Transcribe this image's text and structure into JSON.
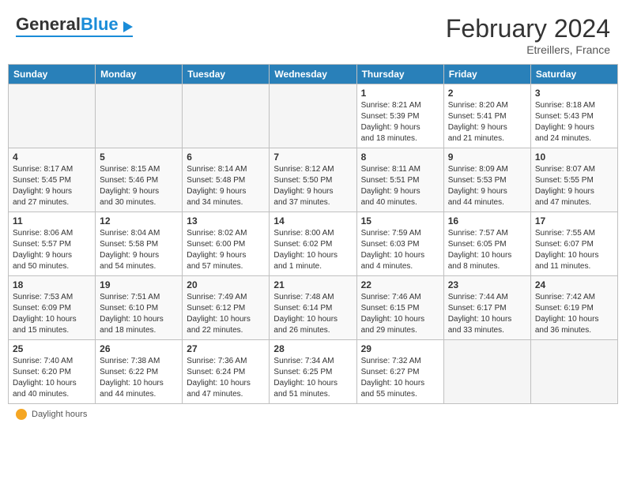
{
  "header": {
    "logo_general": "General",
    "logo_blue": "Blue",
    "month_year": "February 2024",
    "location": "Etreillers, France"
  },
  "days_of_week": [
    "Sunday",
    "Monday",
    "Tuesday",
    "Wednesday",
    "Thursday",
    "Friday",
    "Saturday"
  ],
  "weeks": [
    [
      {
        "day": "",
        "info": ""
      },
      {
        "day": "",
        "info": ""
      },
      {
        "day": "",
        "info": ""
      },
      {
        "day": "",
        "info": ""
      },
      {
        "day": "1",
        "info": "Sunrise: 8:21 AM\nSunset: 5:39 PM\nDaylight: 9 hours\nand 18 minutes."
      },
      {
        "day": "2",
        "info": "Sunrise: 8:20 AM\nSunset: 5:41 PM\nDaylight: 9 hours\nand 21 minutes."
      },
      {
        "day": "3",
        "info": "Sunrise: 8:18 AM\nSunset: 5:43 PM\nDaylight: 9 hours\nand 24 minutes."
      }
    ],
    [
      {
        "day": "4",
        "info": "Sunrise: 8:17 AM\nSunset: 5:45 PM\nDaylight: 9 hours\nand 27 minutes."
      },
      {
        "day": "5",
        "info": "Sunrise: 8:15 AM\nSunset: 5:46 PM\nDaylight: 9 hours\nand 30 minutes."
      },
      {
        "day": "6",
        "info": "Sunrise: 8:14 AM\nSunset: 5:48 PM\nDaylight: 9 hours\nand 34 minutes."
      },
      {
        "day": "7",
        "info": "Sunrise: 8:12 AM\nSunset: 5:50 PM\nDaylight: 9 hours\nand 37 minutes."
      },
      {
        "day": "8",
        "info": "Sunrise: 8:11 AM\nSunset: 5:51 PM\nDaylight: 9 hours\nand 40 minutes."
      },
      {
        "day": "9",
        "info": "Sunrise: 8:09 AM\nSunset: 5:53 PM\nDaylight: 9 hours\nand 44 minutes."
      },
      {
        "day": "10",
        "info": "Sunrise: 8:07 AM\nSunset: 5:55 PM\nDaylight: 9 hours\nand 47 minutes."
      }
    ],
    [
      {
        "day": "11",
        "info": "Sunrise: 8:06 AM\nSunset: 5:57 PM\nDaylight: 9 hours\nand 50 minutes."
      },
      {
        "day": "12",
        "info": "Sunrise: 8:04 AM\nSunset: 5:58 PM\nDaylight: 9 hours\nand 54 minutes."
      },
      {
        "day": "13",
        "info": "Sunrise: 8:02 AM\nSunset: 6:00 PM\nDaylight: 9 hours\nand 57 minutes."
      },
      {
        "day": "14",
        "info": "Sunrise: 8:00 AM\nSunset: 6:02 PM\nDaylight: 10 hours\nand 1 minute."
      },
      {
        "day": "15",
        "info": "Sunrise: 7:59 AM\nSunset: 6:03 PM\nDaylight: 10 hours\nand 4 minutes."
      },
      {
        "day": "16",
        "info": "Sunrise: 7:57 AM\nSunset: 6:05 PM\nDaylight: 10 hours\nand 8 minutes."
      },
      {
        "day": "17",
        "info": "Sunrise: 7:55 AM\nSunset: 6:07 PM\nDaylight: 10 hours\nand 11 minutes."
      }
    ],
    [
      {
        "day": "18",
        "info": "Sunrise: 7:53 AM\nSunset: 6:09 PM\nDaylight: 10 hours\nand 15 minutes."
      },
      {
        "day": "19",
        "info": "Sunrise: 7:51 AM\nSunset: 6:10 PM\nDaylight: 10 hours\nand 18 minutes."
      },
      {
        "day": "20",
        "info": "Sunrise: 7:49 AM\nSunset: 6:12 PM\nDaylight: 10 hours\nand 22 minutes."
      },
      {
        "day": "21",
        "info": "Sunrise: 7:48 AM\nSunset: 6:14 PM\nDaylight: 10 hours\nand 26 minutes."
      },
      {
        "day": "22",
        "info": "Sunrise: 7:46 AM\nSunset: 6:15 PM\nDaylight: 10 hours\nand 29 minutes."
      },
      {
        "day": "23",
        "info": "Sunrise: 7:44 AM\nSunset: 6:17 PM\nDaylight: 10 hours\nand 33 minutes."
      },
      {
        "day": "24",
        "info": "Sunrise: 7:42 AM\nSunset: 6:19 PM\nDaylight: 10 hours\nand 36 minutes."
      }
    ],
    [
      {
        "day": "25",
        "info": "Sunrise: 7:40 AM\nSunset: 6:20 PM\nDaylight: 10 hours\nand 40 minutes."
      },
      {
        "day": "26",
        "info": "Sunrise: 7:38 AM\nSunset: 6:22 PM\nDaylight: 10 hours\nand 44 minutes."
      },
      {
        "day": "27",
        "info": "Sunrise: 7:36 AM\nSunset: 6:24 PM\nDaylight: 10 hours\nand 47 minutes."
      },
      {
        "day": "28",
        "info": "Sunrise: 7:34 AM\nSunset: 6:25 PM\nDaylight: 10 hours\nand 51 minutes."
      },
      {
        "day": "29",
        "info": "Sunrise: 7:32 AM\nSunset: 6:27 PM\nDaylight: 10 hours\nand 55 minutes."
      },
      {
        "day": "",
        "info": ""
      },
      {
        "day": "",
        "info": ""
      }
    ]
  ],
  "footer": {
    "sun_label": "Daylight hours"
  }
}
